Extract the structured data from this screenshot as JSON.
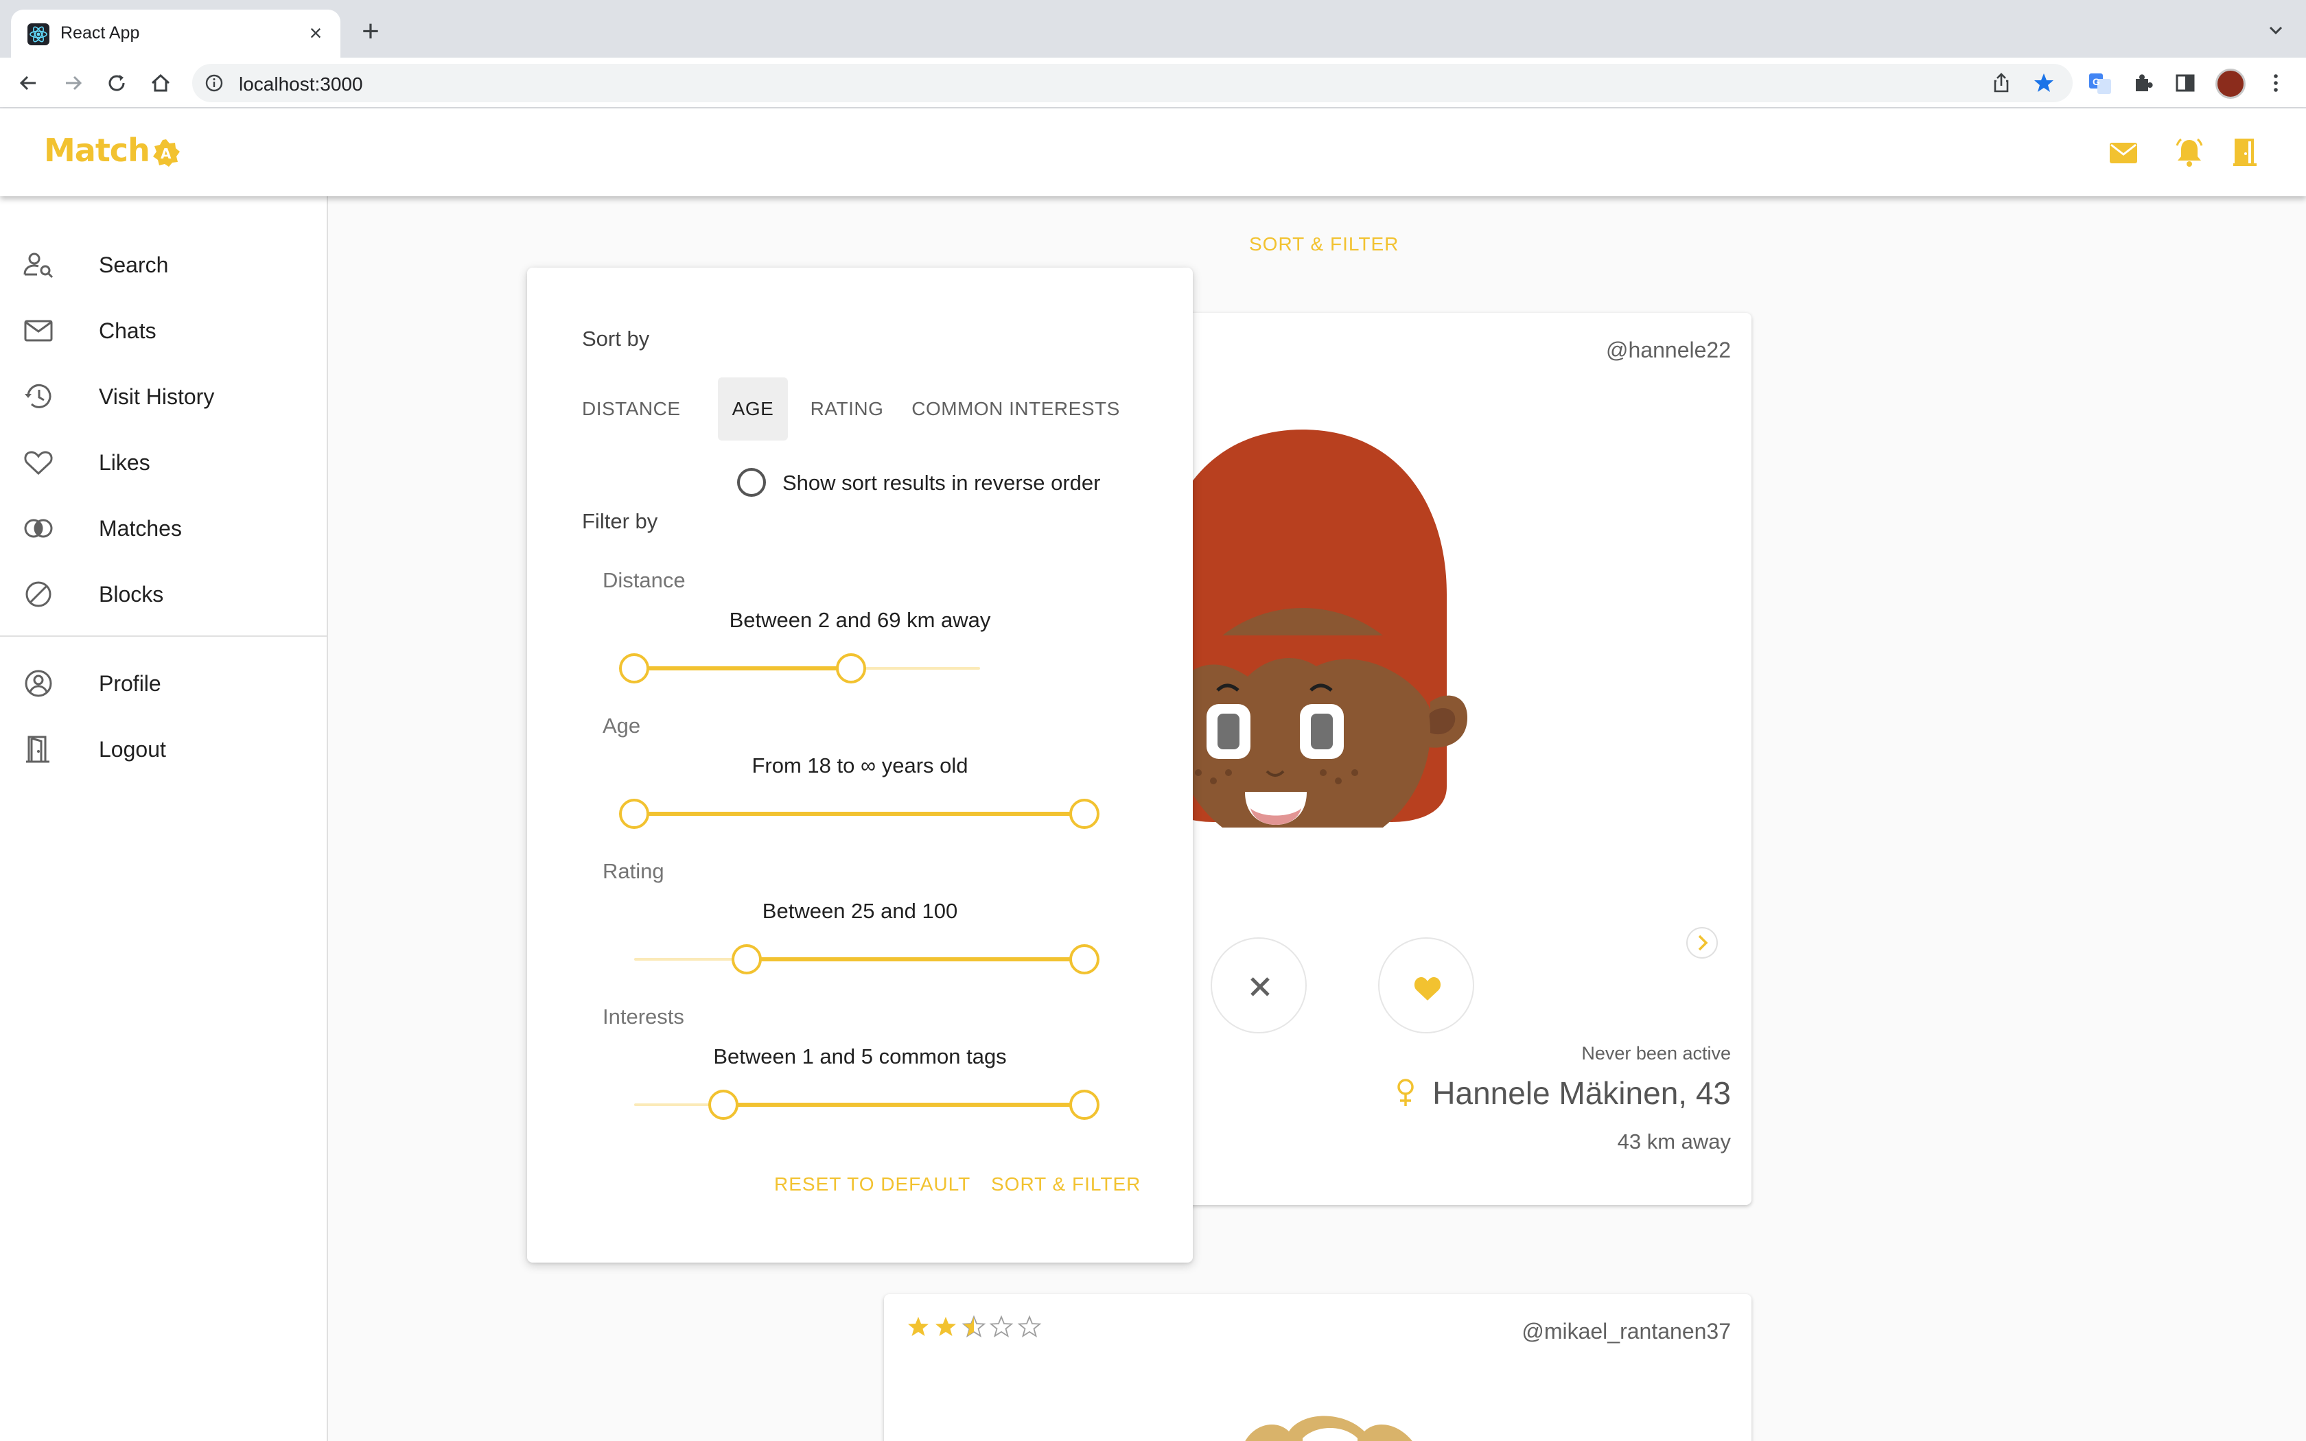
{
  "browser": {
    "tab_title": "React App",
    "tab_close": "×",
    "new_tab": "+",
    "url": "localhost:3000"
  },
  "app": {
    "brand": "Match",
    "accent_color": "#f2c230",
    "header_icons": [
      "mail-icon",
      "bell-icon",
      "door-icon"
    ]
  },
  "drawer": {
    "items": [
      {
        "label": "Search",
        "icon": "user-search-icon"
      },
      {
        "label": "Chats",
        "icon": "mail-icon"
      },
      {
        "label": "Visit History",
        "icon": "history-icon"
      },
      {
        "label": "Likes",
        "icon": "heart-icon"
      },
      {
        "label": "Matches",
        "icon": "matches-icon"
      },
      {
        "label": "Blocks",
        "icon": "block-icon"
      }
    ],
    "secondary_items": [
      {
        "label": "Profile",
        "icon": "account-circle-icon"
      },
      {
        "label": "Logout",
        "icon": "door-icon"
      }
    ]
  },
  "main": {
    "sort_filter_button": "SORT & FILTER"
  },
  "panel": {
    "sort_title": "Sort by",
    "sort_tabs": [
      {
        "label": "DISTANCE",
        "active": false
      },
      {
        "label": "AGE",
        "active": true
      },
      {
        "label": "RATING",
        "active": false
      },
      {
        "label": "COMMON INTERESTS",
        "active": false
      }
    ],
    "reverse_label": "Show sort results in reverse order",
    "reverse_checked": false,
    "filter_title": "Filter by",
    "filters": [
      {
        "label": "Distance",
        "value_text": "Between 2 and 69 km away",
        "range": [
          2,
          69
        ],
        "scale": [
          0,
          100
        ]
      },
      {
        "label": "Age",
        "value_text": "From 18 to ∞ years old",
        "range": [
          18,
          "∞"
        ],
        "scale": [
          18,
          "∞"
        ]
      },
      {
        "label": "Rating",
        "value_text": "Between 25 and 100",
        "range": [
          25,
          100
        ],
        "scale": [
          0,
          100
        ]
      },
      {
        "label": "Interests",
        "value_text": "Between 1 and 5 common tags",
        "range": [
          1,
          5
        ],
        "scale": [
          0,
          5
        ]
      }
    ],
    "reset_button": "RESET TO DEFAULT",
    "apply_button": "SORT & FILTER"
  },
  "profiles": [
    {
      "username": "@hannele22",
      "last_active": "Never been active",
      "name": "Hannele Mäkinen, 43",
      "distance": "43 km away",
      "gender_icon": "female-icon",
      "hair_color": "#b8401f",
      "skin_color": "#8a5732"
    },
    {
      "username": "@mikael_rantanen37",
      "rating_stars": 2.5,
      "rating_max": 5
    }
  ]
}
